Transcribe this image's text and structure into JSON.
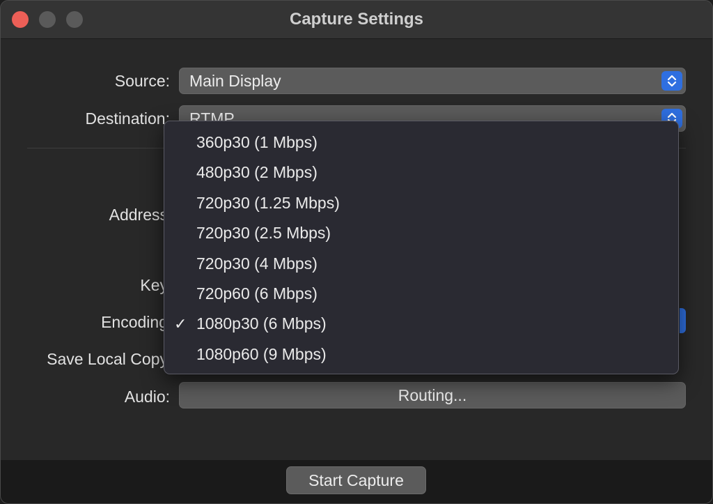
{
  "window": {
    "title": "Capture Settings"
  },
  "form": {
    "source_label": "Source:",
    "source_value": "Main Display",
    "destination_label": "Destination:",
    "destination_value": "RTMP",
    "address_label": "Address",
    "key_label": "Key",
    "encoding_label": "Encoding",
    "save_local_copy_label": "Save Local Copy",
    "audio_label": "Audio:",
    "routing_button": "Routing..."
  },
  "encoding_menu": {
    "items": [
      {
        "label": "360p30 (1 Mbps)",
        "checked": false
      },
      {
        "label": "480p30 (2 Mbps)",
        "checked": false
      },
      {
        "label": "720p30 (1.25 Mbps)",
        "checked": false
      },
      {
        "label": "720p30 (2.5 Mbps)",
        "checked": false
      },
      {
        "label": "720p30 (4 Mbps)",
        "checked": false
      },
      {
        "label": "720p60 (6 Mbps)",
        "checked": false
      },
      {
        "label": "1080p30 (6 Mbps)",
        "checked": true
      },
      {
        "label": "1080p60 (9 Mbps)",
        "checked": false
      }
    ],
    "check_glyph": "✓"
  },
  "footer": {
    "start_button": "Start Capture"
  },
  "colors": {
    "accent": "#2f6fe0",
    "close": "#ec5f57"
  }
}
